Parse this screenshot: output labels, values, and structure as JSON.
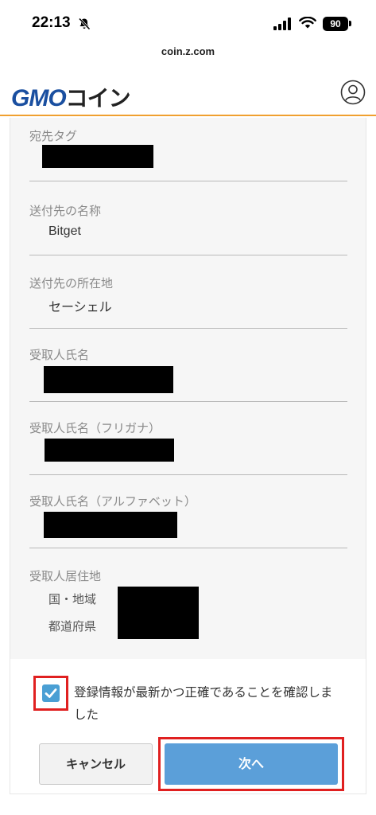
{
  "status_bar": {
    "time": "22:13",
    "battery": "90"
  },
  "browser": {
    "url": "coin.z.com"
  },
  "header": {
    "logo_gmo": "GMO",
    "logo_coin": "コイン"
  },
  "fields": [
    {
      "label": "宛先タグ"
    },
    {
      "label": "送付先の名称",
      "value": "Bitget"
    },
    {
      "label": "送付先の所在地",
      "value": "セーシェル"
    },
    {
      "label": "受取人氏名"
    },
    {
      "label": "受取人氏名（フリガナ）"
    },
    {
      "label": "受取人氏名（アルファベット）"
    },
    {
      "label": "受取人居住地",
      "sub_labels": [
        "国・地域",
        "都道府県"
      ]
    }
  ],
  "confirm": {
    "text": "登録情報が最新かつ正確であることを確認しました",
    "checked": true
  },
  "buttons": {
    "cancel": "キャンセル",
    "next": "次へ"
  }
}
